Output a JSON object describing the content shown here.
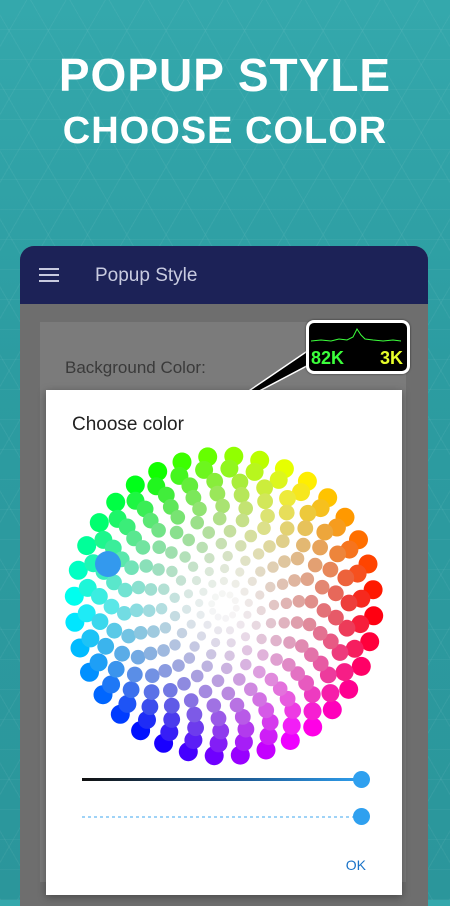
{
  "promo": {
    "line1": "POPUP STYLE",
    "line2": "CHOOSE COLOR"
  },
  "app": {
    "title": "Popup Style",
    "menu_icon": "hamburger-menu-icon",
    "settings": {
      "background_color_label": "Background Color:"
    }
  },
  "dialog": {
    "title": "Choose color",
    "ok_label": "OK",
    "selected_color": "#3399ee",
    "lightness_level": 1.0,
    "alpha_level": 1.0
  },
  "overlay_widget": {
    "value_a": "82K",
    "value_b": "3K",
    "value_a_color": "#3cff3c",
    "value_b_color": "#e8ff2a"
  },
  "colors": {
    "app_bar": "#1c2257",
    "accent": "#2fa0ef",
    "background": "#2c9ca1"
  }
}
